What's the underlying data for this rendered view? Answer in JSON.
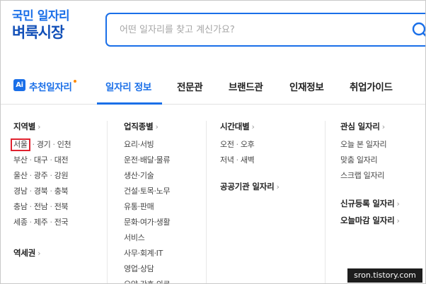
{
  "logo": {
    "line1": "국민 일자리",
    "line2": "벼룩시장"
  },
  "search": {
    "placeholder": "어떤 일자리를 찾고 계신가요?"
  },
  "nav": {
    "ai_badge": "Ai",
    "items": [
      {
        "label": "추천일자리"
      },
      {
        "label": "일자리 정보"
      },
      {
        "label": "전문관"
      },
      {
        "label": "브랜드관"
      },
      {
        "label": "인재정보"
      },
      {
        "label": "취업가이드"
      }
    ]
  },
  "region": {
    "title": "지역별",
    "rows": [
      [
        "서울",
        "경기",
        "인천"
      ],
      [
        "부산",
        "대구",
        "대전"
      ],
      [
        "울산",
        "광주",
        "강원"
      ],
      [
        "경남",
        "경북",
        "충북"
      ],
      [
        "충남",
        "전남",
        "전북"
      ],
      [
        "세종",
        "제주",
        "전국"
      ]
    ],
    "station_title": "역세권"
  },
  "jobtype": {
    "title": "업직종별",
    "items": [
      "요리·서빙",
      "운전·배달·물류",
      "생산·기술",
      "건설·토목·노무",
      "유통·판매",
      "문화·여가·생활",
      "서비스",
      "사무·회계·IT",
      "영업·상담",
      "요양·간호·의료"
    ]
  },
  "time": {
    "title": "시간대별",
    "rows": [
      [
        "오전",
        "오후"
      ],
      [
        "저녁",
        "새벽"
      ]
    ],
    "public_title": "공공기관 일자리"
  },
  "interest": {
    "title": "관심 일자리",
    "items": [
      "오늘 본 일자리",
      "맞춤 일자리",
      "스크랩 일자리"
    ],
    "new_title": "신규등록 일자리",
    "closing_title": "오늘마감 일자리"
  },
  "watermark": "sron.tistory.com",
  "colors": {
    "primary": "#1a6fe8",
    "highlight": "#e0222f",
    "dot": "#ff8a00"
  }
}
